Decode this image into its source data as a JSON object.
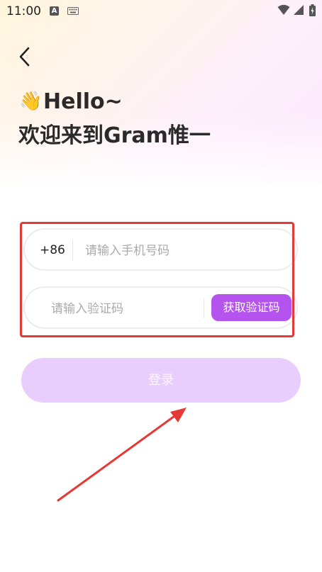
{
  "status_bar": {
    "time": "11:00",
    "icons": [
      "a-icon",
      "keyboard-icon",
      "wifi-icon",
      "signal-icon",
      "battery-icon"
    ],
    "a_glyph": "A"
  },
  "header": {
    "back_icon": "chevron-left-icon",
    "wave_icon": "👋",
    "greeting": "Hello~",
    "welcome": "欢迎来到Gram惟一"
  },
  "form": {
    "country_code": "+86",
    "phone_placeholder": "请输入手机号码",
    "code_placeholder": "请输入验证码",
    "get_code_label": "获取验证码"
  },
  "login": {
    "label": "登录"
  },
  "colors": {
    "accent": "#b453ee",
    "login_disabled": "#e9cdfc",
    "annotation": "#e53935"
  }
}
